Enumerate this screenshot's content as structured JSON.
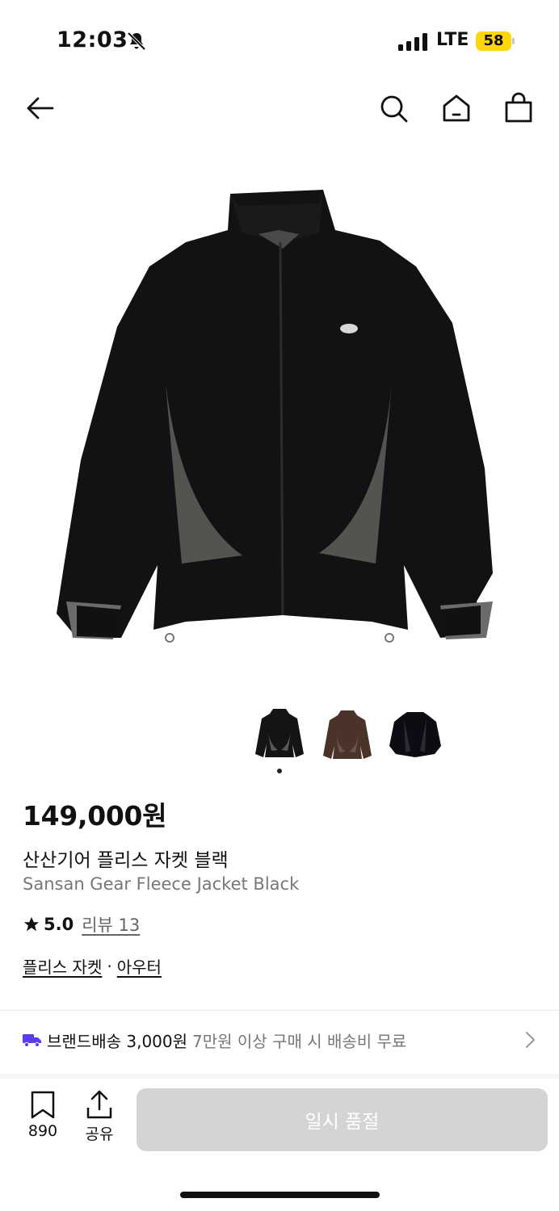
{
  "status": {
    "time": "12:03",
    "network": "LTE",
    "battery": "58"
  },
  "nav": {
    "back_icon": "arrow-left-icon",
    "search_icon": "search-icon",
    "home_icon": "home-icon",
    "cart_icon": "shopping-bag-icon"
  },
  "product": {
    "price": "149,000원",
    "name_ko": "산산기어 플리스 자켓 블랙",
    "name_en": "Sansan Gear Fleece Jacket Black",
    "rating": "5.0",
    "review_label": "리뷰 13",
    "category_1": "플리스 자켓",
    "separator": "·",
    "category_2": "아우터"
  },
  "shipping": {
    "label": "브랜드배송 3,000원",
    "condition": "7만원 이상 구매 시 배송비 무료"
  },
  "bottom": {
    "bookmark_count": "890",
    "share_label": "공유",
    "buy_label": "일시 품절"
  },
  "colors": {
    "accent": "#5b3cf0",
    "button_disabled": "#d4d4d4",
    "battery": "#ffd60a"
  }
}
